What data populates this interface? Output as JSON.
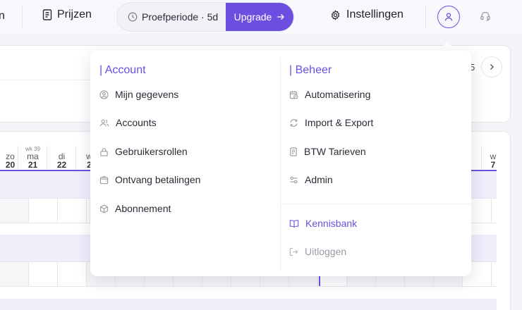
{
  "nav": {
    "partial_left_label": "n",
    "prijzen_label": "Prijzen",
    "trial_label": "Proefperiode · 5d",
    "upgrade_label": "Upgrade",
    "settings_label": "Instellingen"
  },
  "panel": {
    "page_number": "5"
  },
  "calendar": {
    "days": [
      {
        "week": "",
        "day": "zo",
        "date": "20"
      },
      {
        "week": "wk 39",
        "day": "ma",
        "date": "21"
      },
      {
        "week": "",
        "day": "di",
        "date": "22"
      },
      {
        "week": "",
        "day": "w",
        "date": "2"
      }
    ],
    "right_day": {
      "day": "w",
      "date": "7"
    }
  },
  "menu": {
    "account": {
      "heading": "| Account",
      "items": [
        {
          "label": "Mijn gegevens",
          "icon": "user-circle-icon"
        },
        {
          "label": "Accounts",
          "icon": "users-icon"
        },
        {
          "label": "Gebruikersrollen",
          "icon": "lock-icon"
        },
        {
          "label": "Ontvang betalingen",
          "icon": "wallet-icon"
        },
        {
          "label": "Abonnement",
          "icon": "box-icon"
        }
      ]
    },
    "beheer": {
      "heading": "| Beheer",
      "items": [
        {
          "label": "Automatisering",
          "icon": "calendar-clock-icon"
        },
        {
          "label": "Import & Export",
          "icon": "refresh-icon"
        },
        {
          "label": "BTW Tarieven",
          "icon": "receipt-icon"
        },
        {
          "label": "Admin",
          "icon": "toggles-icon"
        }
      ]
    },
    "kennisbank_label": "Kennisbank",
    "logout_label": "Uitloggen"
  },
  "colors": {
    "accent": "#6c4fe0",
    "muted": "#9a9aa6"
  }
}
